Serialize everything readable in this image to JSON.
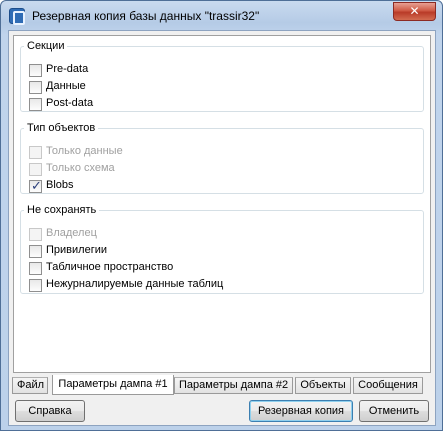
{
  "window": {
    "title": "Резервная копия базы данных \"trassir32\"",
    "close_glyph": "✕"
  },
  "groups": {
    "sections": {
      "title": "Секции",
      "items": [
        {
          "label": "Pre-data",
          "checked": false,
          "disabled": false
        },
        {
          "label": "Данные",
          "checked": false,
          "disabled": false
        },
        {
          "label": "Post-data",
          "checked": false,
          "disabled": false
        }
      ]
    },
    "object_type": {
      "title": "Тип объектов",
      "items": [
        {
          "label": "Только данные",
          "checked": false,
          "disabled": true
        },
        {
          "label": "Только схема",
          "checked": false,
          "disabled": true
        },
        {
          "label": "Blobs",
          "checked": true,
          "disabled": false
        }
      ]
    },
    "do_not_save": {
      "title": "Не сохранять",
      "items": [
        {
          "label": "Владелец",
          "checked": false,
          "disabled": true
        },
        {
          "label": "Привилегии",
          "checked": false,
          "disabled": false
        },
        {
          "label": "Табличное пространство",
          "checked": false,
          "disabled": false
        },
        {
          "label": "Нежурналируемые данные таблиц",
          "checked": false,
          "disabled": false
        }
      ]
    }
  },
  "tabs": [
    {
      "label": "Файл",
      "active": false
    },
    {
      "label": "Параметры дампа #1",
      "active": true
    },
    {
      "label": "Параметры дампа #2",
      "active": false
    },
    {
      "label": "Объекты",
      "active": false
    },
    {
      "label": "Сообщения",
      "active": false
    }
  ],
  "buttons": {
    "help": "Справка",
    "backup": "Резервная копия",
    "cancel": "Отменить"
  }
}
